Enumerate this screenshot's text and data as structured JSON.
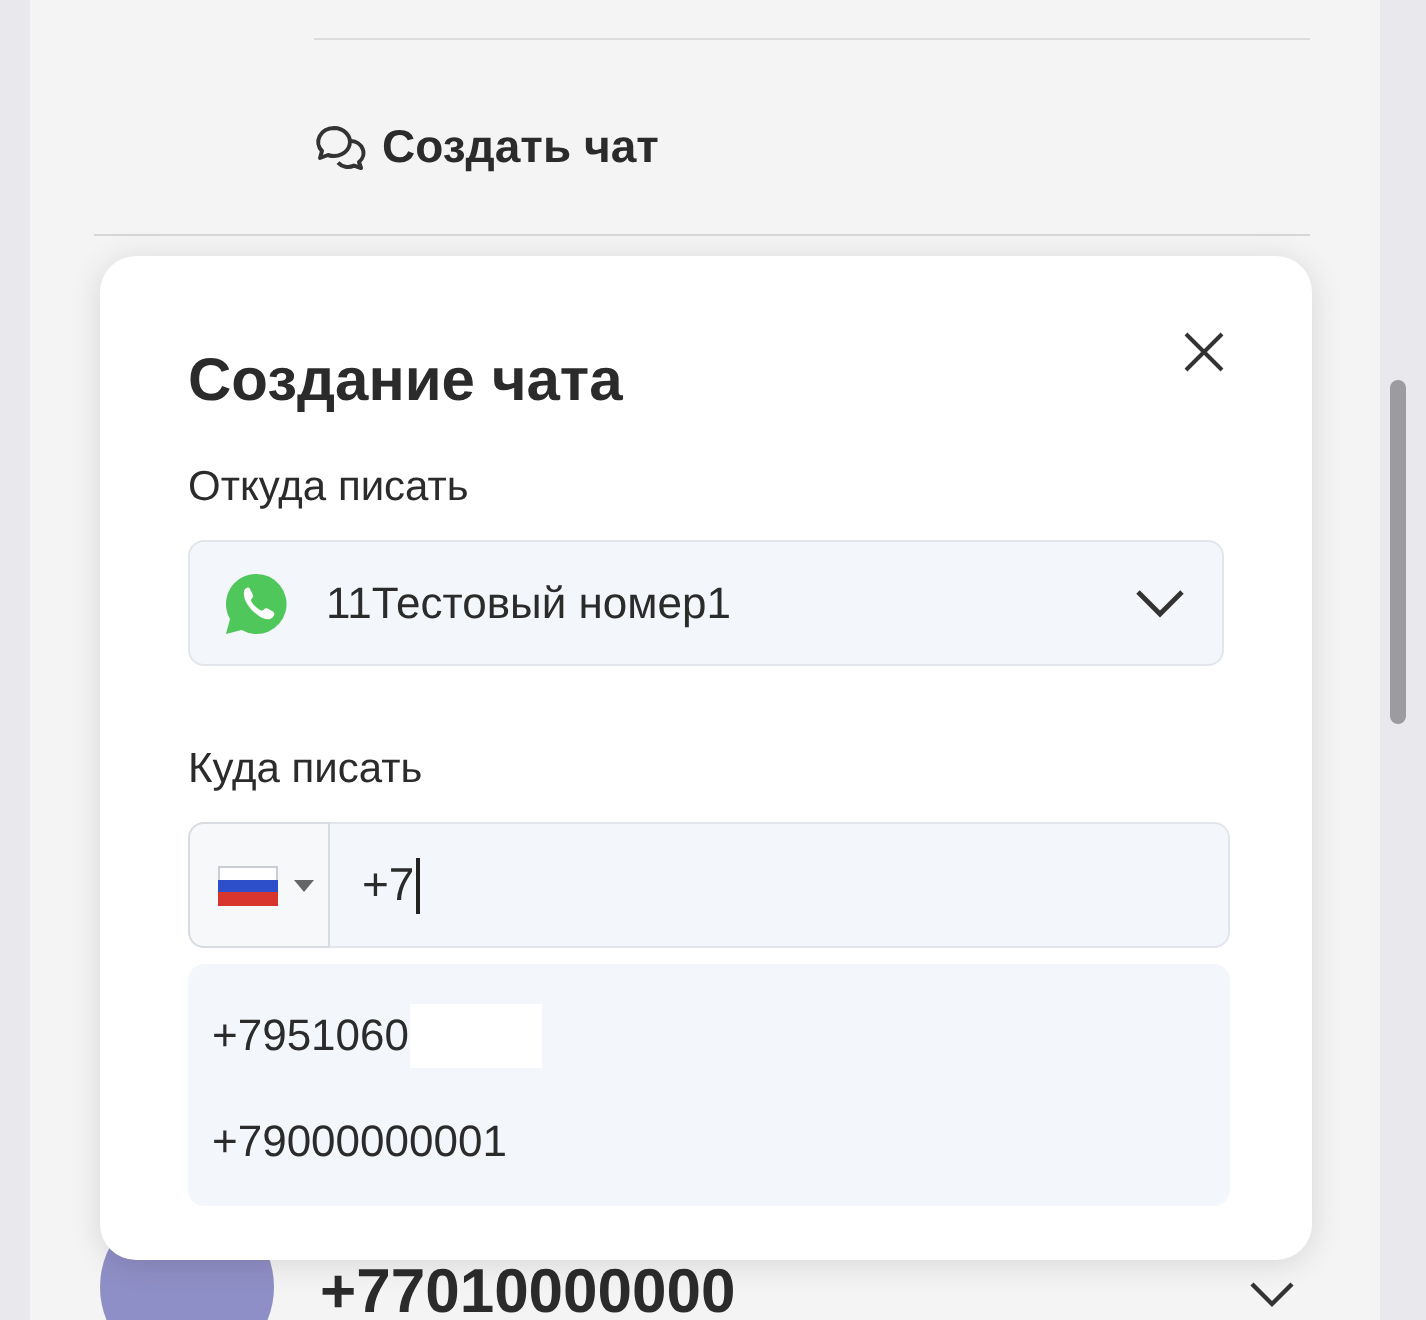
{
  "background": {
    "action": "Создать чат",
    "contact": "+77010000000"
  },
  "dialog": {
    "title": "Создание чата",
    "from_label": "Откуда писать",
    "from_value": "11Тестовый номер1",
    "to_label": "Куда писать",
    "phone_value": "+7",
    "suggestions": [
      {
        "number": "+7951060",
        "redacted": true
      },
      {
        "number": "+79000000001",
        "redacted": false
      }
    ]
  }
}
